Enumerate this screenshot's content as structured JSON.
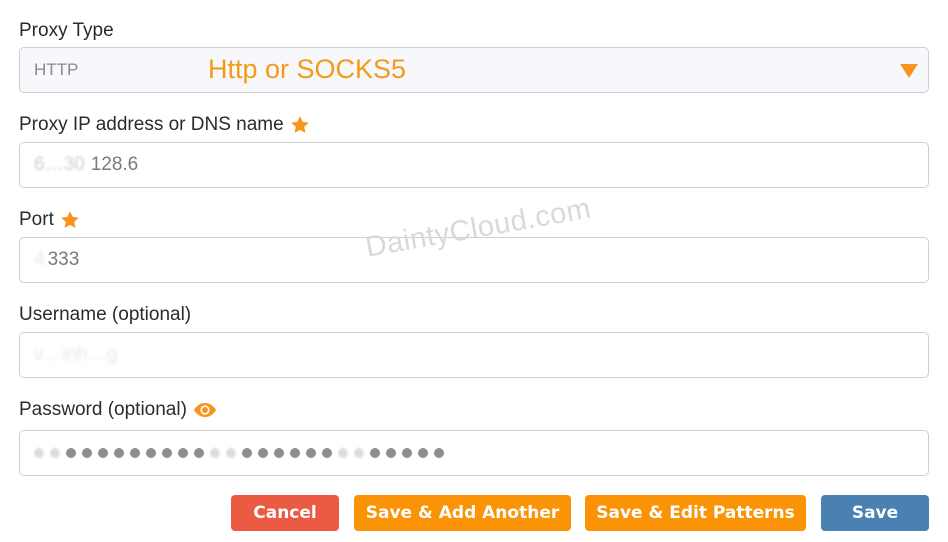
{
  "form": {
    "proxy_type": {
      "label": "Proxy Type",
      "selected": "HTTP",
      "annotation": "Http or SOCKS5",
      "dropdown_icon": "caret-down-icon"
    },
    "proxy_host": {
      "label": "Proxy IP address or DNS name",
      "required_icon": "star-icon",
      "value_obscured": "6…30",
      "value_visible": "128.6"
    },
    "port": {
      "label": "Port",
      "required_icon": "star-icon",
      "value_obscured": "4",
      "value_visible": "333"
    },
    "username": {
      "label": "Username (optional)",
      "value_obscured": "v…inh…g"
    },
    "password": {
      "label": "Password (optional)",
      "toggle_icon": "eye-icon",
      "masked_groups": [
        9,
        6,
        5
      ]
    }
  },
  "watermark": "DaintyCloud.com",
  "buttons": {
    "cancel": "Cancel",
    "save_add_another": "Save & Add Another",
    "save_edit_patterns": "Save & Edit Patterns",
    "save": "Save"
  },
  "colors": {
    "accent_orange": "#fb9306",
    "cancel_red": "#eb5b44",
    "save_blue": "#4a80b2",
    "annotation_orange": "#f59a16"
  }
}
